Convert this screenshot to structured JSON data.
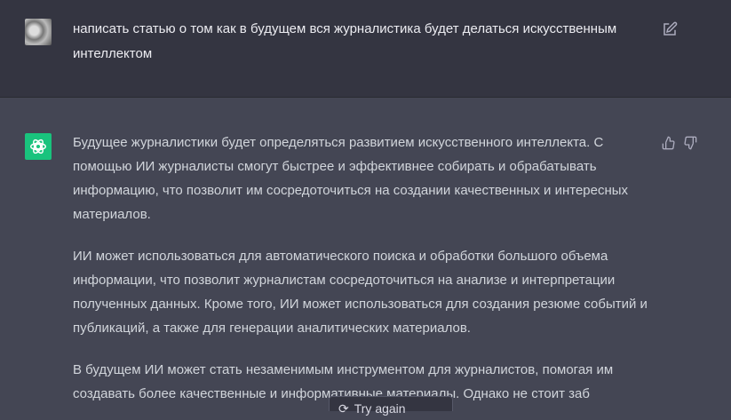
{
  "user_message": {
    "text": "написать статью о том как в будущем вся журналистика будет делаться искусственным интеллектом"
  },
  "assistant_message": {
    "paragraphs": [
      "Будущее журналистики будет определяться развитием искусственного интеллекта. С помощью ИИ журналисты смогут быстрее и эффективнее собирать и обрабатывать информацию, что позволит им сосредоточиться на создании качественных и интересных материалов.",
      "ИИ может использоваться для автоматического поиска и обработки большого объема информации, что позволит журналистам сосредоточиться на анализе и интерпретации полученных данных. Кроме того, ИИ может использоваться для создания резюме событий и публикаций, а также для генерации аналитических материалов.",
      "В будущем ИИ может стать незаменимым инструментом для журналистов, помогая им создавать более качественные и информативные материалы. Однако не стоит заб"
    ]
  },
  "regenerate_button": {
    "label": "Try again"
  },
  "colors": {
    "accent": "#19c37d",
    "user_bg": "#343541",
    "assistant_bg": "#444654"
  }
}
